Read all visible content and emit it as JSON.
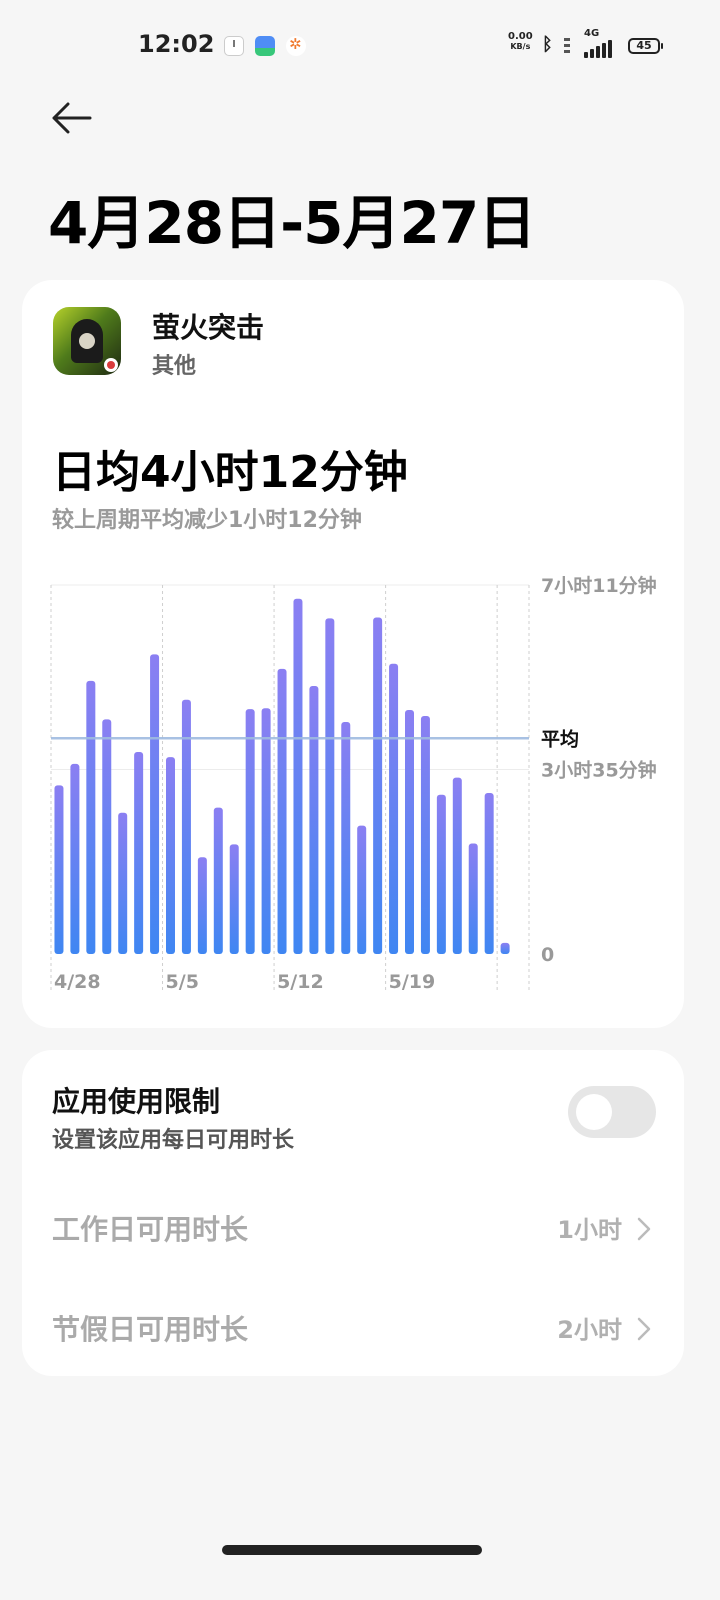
{
  "status_bar": {
    "time": "12:02",
    "net_speed_value": "0.00",
    "net_speed_unit": "KB/s",
    "network_type": "4G",
    "battery": "45",
    "icons": [
      "clock-icon",
      "app-notification-icon",
      "orange-app-icon",
      "bluetooth-icon",
      "signal-icon",
      "battery-icon"
    ]
  },
  "header": {
    "back_icon": "arrow-left-icon",
    "title": "4月28日-5月27日"
  },
  "app": {
    "name": "萤火突击",
    "category": "其他"
  },
  "summary": {
    "daily_average": "日均4小时12分钟",
    "comparison": "较上周期平均减少1小时12分钟"
  },
  "chart_data": {
    "type": "bar",
    "x": [
      "4/28",
      "4/29",
      "4/30",
      "5/1",
      "5/2",
      "5/3",
      "5/4",
      "5/5",
      "5/6",
      "5/7",
      "5/8",
      "5/9",
      "5/10",
      "5/11",
      "5/12",
      "5/13",
      "5/14",
      "5/15",
      "5/16",
      "5/17",
      "5/18",
      "5/19",
      "5/20",
      "5/21",
      "5/22",
      "5/23",
      "5/24",
      "5/25",
      "5/26",
      "5/27"
    ],
    "x_tick_labels": [
      "4/28",
      "5/5",
      "5/12",
      "5/19"
    ],
    "y_unit": "minutes",
    "values": [
      197,
      222,
      319,
      274,
      165,
      236,
      350,
      230,
      297,
      113,
      171,
      128,
      286,
      287,
      333,
      415,
      313,
      392,
      271,
      150,
      393,
      339,
      285,
      278,
      186,
      206,
      129,
      188,
      13,
      0
    ],
    "average": 252,
    "ylim": [
      0,
      431
    ],
    "y_tick_labels": [
      "7小时11分钟",
      "3小时35分钟",
      "0"
    ],
    "average_label": "平均",
    "colors": {
      "bar_top": "#8b7ff2",
      "bar_bottom": "#3f86f2",
      "average_line": "#9fbbe0"
    }
  },
  "limit": {
    "title": "应用使用限制",
    "subtitle": "设置该应用每日可用时长",
    "enabled": false,
    "workday_label": "工作日可用时长",
    "workday_value": "1小时",
    "holiday_label": "节假日可用时长",
    "holiday_value": "2小时"
  }
}
